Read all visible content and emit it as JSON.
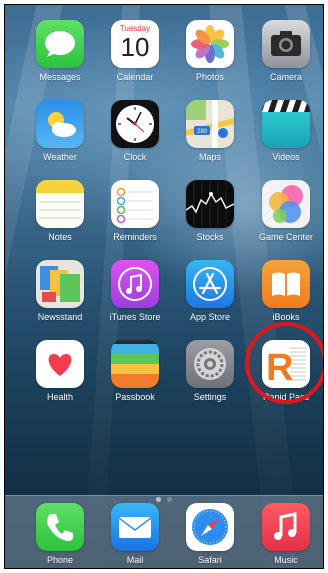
{
  "calendar": {
    "weekday": "Tuesday",
    "day": "10"
  },
  "apps": [
    {
      "label": "Messages"
    },
    {
      "label": "Calendar"
    },
    {
      "label": "Photos"
    },
    {
      "label": "Camera"
    },
    {
      "label": "Weather"
    },
    {
      "label": "Clock"
    },
    {
      "label": "Maps"
    },
    {
      "label": "Videos"
    },
    {
      "label": "Notes"
    },
    {
      "label": "Reminders"
    },
    {
      "label": "Stocks"
    },
    {
      "label": "Game Center"
    },
    {
      "label": "Newsstand"
    },
    {
      "label": "iTunes Store"
    },
    {
      "label": "App Store"
    },
    {
      "label": "iBooks"
    },
    {
      "label": "Health"
    },
    {
      "label": "Passbook"
    },
    {
      "label": "Settings"
    },
    {
      "label": "Rapid Pass"
    }
  ],
  "maps_sign": "280",
  "dock": [
    {
      "label": "Phone"
    },
    {
      "label": "Mail"
    },
    {
      "label": "Safari"
    },
    {
      "label": "Music"
    }
  ],
  "page_indicator": {
    "pages": 2,
    "current": 1
  },
  "highlight": {
    "target": "Rapid Pass",
    "color": "#e0161b"
  },
  "colors": {
    "messages": "#3fcf4f",
    "phone": "#3fcf4f",
    "music": "#f23c4f",
    "health_heart": "#f23c4f"
  }
}
